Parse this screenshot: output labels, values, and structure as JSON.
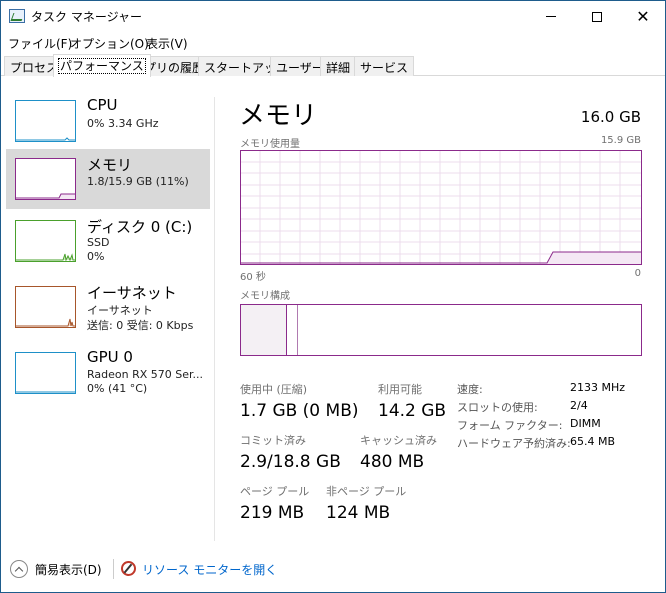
{
  "window": {
    "title": "タスク マネージャー",
    "icon": "task-manager-icon"
  },
  "menu": {
    "items": [
      {
        "label": "ファイル(F)"
      },
      {
        "label": "オプション(O)"
      },
      {
        "label": "表示(V)"
      }
    ]
  },
  "tabs": [
    {
      "label": "プロセス",
      "active": false
    },
    {
      "label": "パフォーマンス",
      "active": true
    },
    {
      "label": "アプリの履歴",
      "active": false
    },
    {
      "label": "スタートアップ",
      "active": false
    },
    {
      "label": "ユーザー",
      "active": false
    },
    {
      "label": "詳細",
      "active": false
    },
    {
      "label": "サービス",
      "active": false
    }
  ],
  "sidebar": {
    "items": [
      {
        "name": "CPU",
        "sub1": "0%  3.34 GHz",
        "sub2": "",
        "color": "#1e90c8",
        "selected": false
      },
      {
        "name": "メモリ",
        "sub1": "1.8/15.9 GB (11%)",
        "sub2": "",
        "color": "#8b2a8b",
        "selected": true
      },
      {
        "name": "ディスク 0 (C:)",
        "sub1": "SSD",
        "sub2": "0%",
        "color": "#4aa02c",
        "selected": false
      },
      {
        "name": "イーサネット",
        "sub1": "イーサネット",
        "sub2": "送信: 0 受信: 0 Kbps",
        "color": "#a7562b",
        "selected": false
      },
      {
        "name": "GPU 0",
        "sub1": "Radeon RX 570 Ser...",
        "sub2": "0% (41 °C)",
        "color": "#1e90c8",
        "selected": false
      }
    ]
  },
  "main": {
    "title": "メモリ",
    "total": "16.0 GB",
    "chart_left_label": "メモリ使用量",
    "chart_right_label": "15.9 GB",
    "axis_left": "60 秒",
    "axis_right": "0",
    "composition_label": "メモリ構成",
    "accent_color": "#8b2a8b"
  },
  "stats": {
    "in_use": {
      "label": "使用中 (圧縮)",
      "value": "1.7 GB (0 MB)"
    },
    "available": {
      "label": "利用可能",
      "value": "14.2 GB"
    },
    "committed": {
      "label": "コミット済み",
      "value": "2.9/18.8 GB"
    },
    "cached": {
      "label": "キャッシュ済み",
      "value": "480 MB"
    },
    "paged_pool": {
      "label": "ページ プール",
      "value": "219 MB"
    },
    "nonpaged_pool": {
      "label": "非ページ プール",
      "value": "124 MB"
    }
  },
  "specs": [
    {
      "label": "速度:",
      "value": "2133 MHz"
    },
    {
      "label": "スロットの使用:",
      "value": "2/4"
    },
    {
      "label": "フォーム ファクター:",
      "value": "DIMM"
    },
    {
      "label": "ハードウェア予約済み:",
      "value": "65.4 MB"
    }
  ],
  "footer": {
    "fewer_details": "簡易表示(D)",
    "resource_monitor": "リソース モニターを開く"
  }
}
